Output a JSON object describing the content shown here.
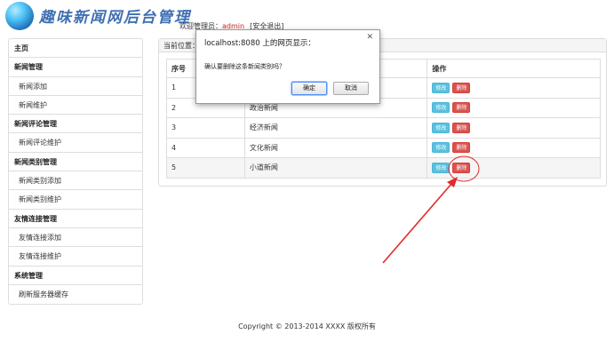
{
  "header": {
    "title": "趣味新闻网后台管理",
    "welcome_prefix": "欢迎管理员：",
    "username": "admin",
    "logout": "[安全退出]"
  },
  "sidebar": {
    "items": [
      {
        "label": "主页",
        "type": "head"
      },
      {
        "label": "新闻管理",
        "type": "head"
      },
      {
        "label": "新闻添加",
        "type": "sub"
      },
      {
        "label": "新闻维护",
        "type": "sub"
      },
      {
        "label": "新闻评论管理",
        "type": "head"
      },
      {
        "label": "新闻评论维护",
        "type": "sub"
      },
      {
        "label": "新闻类别管理",
        "type": "head"
      },
      {
        "label": "新闻类别添加",
        "type": "sub"
      },
      {
        "label": "新闻类别维护",
        "type": "sub"
      },
      {
        "label": "友情连接管理",
        "type": "head"
      },
      {
        "label": "友情连接添加",
        "type": "sub"
      },
      {
        "label": "友情连接维护",
        "type": "sub"
      },
      {
        "label": "系统管理",
        "type": "head"
      },
      {
        "label": "刷新服务器缓存",
        "type": "sub"
      }
    ]
  },
  "panel": {
    "location": "当前位置："
  },
  "table": {
    "headers": [
      "序号",
      "",
      "操作"
    ],
    "rows": [
      {
        "id": "1",
        "name": ""
      },
      {
        "id": "2",
        "name": "政治新闻"
      },
      {
        "id": "3",
        "name": "经济新闻"
      },
      {
        "id": "4",
        "name": "文化新闻"
      },
      {
        "id": "5",
        "name": "小道新闻"
      }
    ],
    "edit_label": "修改",
    "delete_label": "删除"
  },
  "dialog": {
    "title": "localhost:8080 上的网页显示：",
    "close": "✕",
    "message": "确认要删除这条新闻类别吗？",
    "ok": "确定",
    "cancel": "取消"
  },
  "footer": "Copyright © 2013-2014 XXXX 版权所有",
  "colors": {
    "accent_red": "#e32a2a",
    "edit": "#5bc0de",
    "delete": "#d9534f"
  }
}
